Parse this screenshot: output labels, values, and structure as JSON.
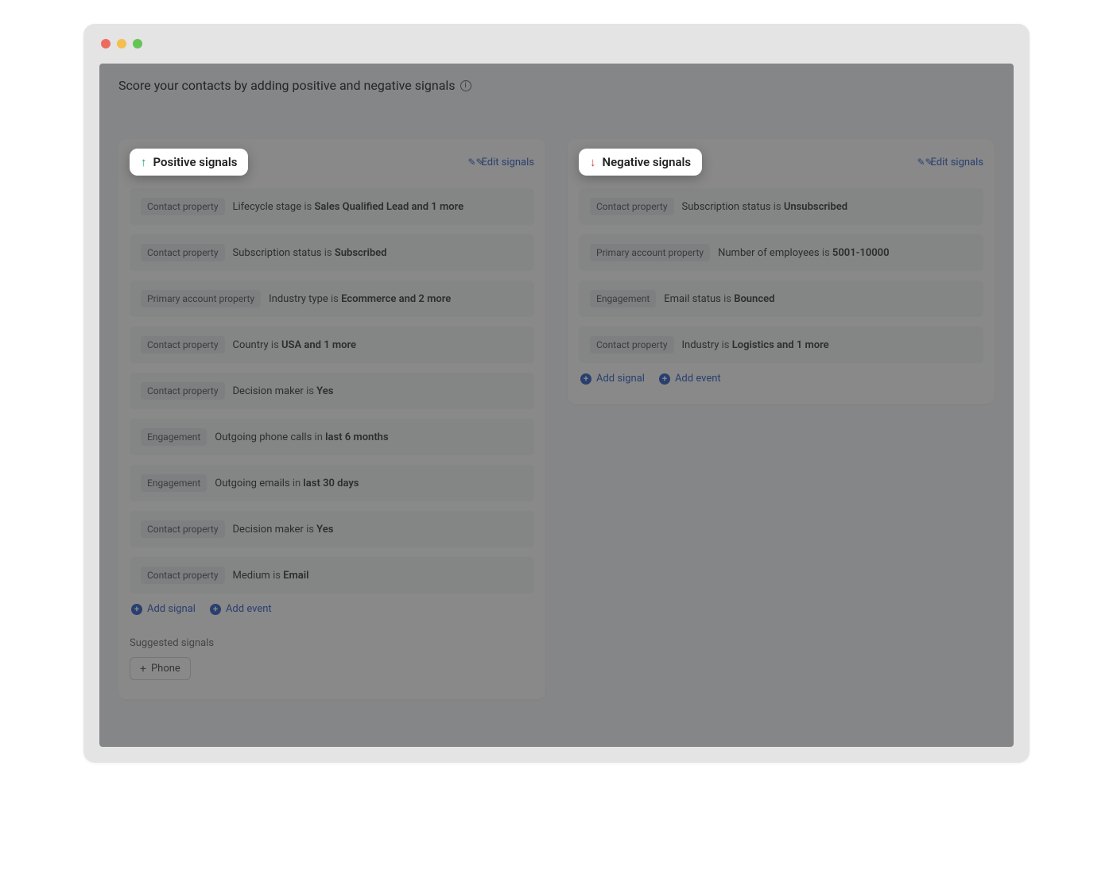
{
  "header": {
    "title": "Score your contacts by adding positive and negative signals"
  },
  "positive": {
    "title": "Positive signals",
    "edit_label": "Edit signals",
    "signals": [
      {
        "category": "Contact property",
        "field": "Lifecycle stage",
        "connector": "is",
        "value": "Sales Qualified Lead and 1 more"
      },
      {
        "category": "Contact property",
        "field": "Subscription status",
        "connector": "is",
        "value": "Subscribed"
      },
      {
        "category": "Primary account property",
        "field": "Industry type",
        "connector": "is",
        "value": "Ecommerce and 2 more"
      },
      {
        "category": "Contact property",
        "field": "Country",
        "connector": "is",
        "value": "USA and 1 more"
      },
      {
        "category": "Contact property",
        "field": "Decision maker",
        "connector": "is",
        "value": "Yes"
      },
      {
        "category": "Engagement",
        "field": "Outgoing phone calls",
        "connector": "in",
        "value": "last 6 months"
      },
      {
        "category": "Engagement",
        "field": "Outgoing emails",
        "connector": "in",
        "value": "last 30 days"
      },
      {
        "category": "Contact property",
        "field": "Decision maker",
        "connector": "is",
        "value": "Yes"
      },
      {
        "category": "Contact property",
        "field": "Medium",
        "connector": "is",
        "value": "Email"
      }
    ],
    "add_signal_label": "Add signal",
    "add_event_label": "Add event",
    "suggested_title": "Suggested signals",
    "suggested_chip": "Phone"
  },
  "negative": {
    "title": "Negative signals",
    "edit_label": "Edit signals",
    "signals": [
      {
        "category": "Contact property",
        "field": "Subscription status",
        "connector": "is",
        "value": "Unsubscribed"
      },
      {
        "category": "Primary account property",
        "field": "Number of employees",
        "connector": "is",
        "value": "5001-10000"
      },
      {
        "category": "Engagement",
        "field": "Email status",
        "connector": "is",
        "value": "Bounced"
      },
      {
        "category": "Contact property",
        "field": "Industry",
        "connector": "is",
        "value": "Logistics and 1 more"
      }
    ],
    "add_signal_label": "Add signal",
    "add_event_label": "Add event"
  }
}
